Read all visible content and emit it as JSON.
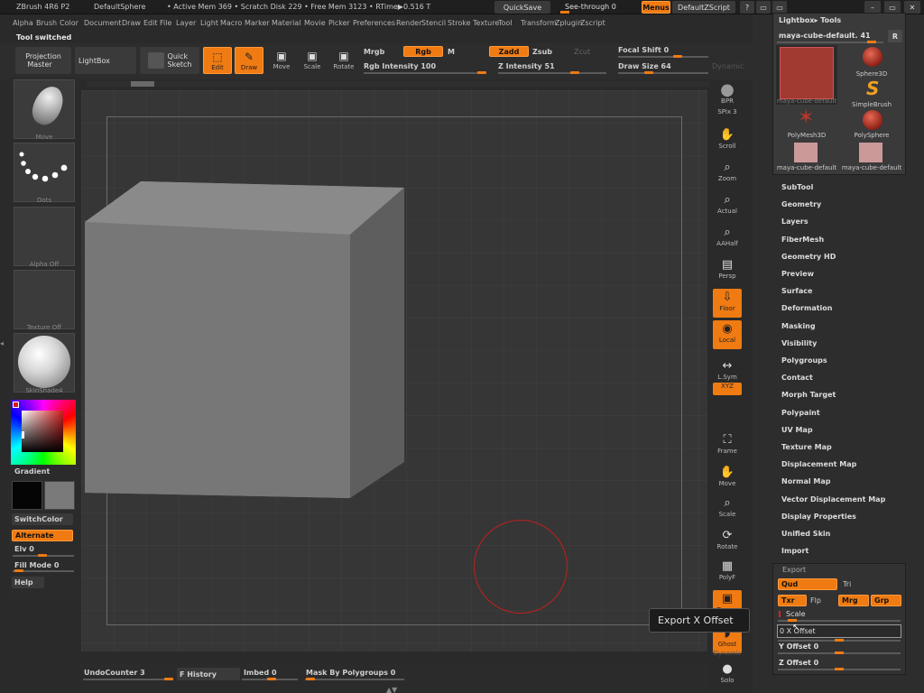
{
  "title_bar": {
    "app": "ZBrush 4R6 P2",
    "doc": "DefaultSphere",
    "stats": "• Active Mem 369 • Scratch Disk 229 • Free Mem 3123 • RTime▶0.516 T",
    "quicksave": "QuickSave",
    "see_through": "See-through  0",
    "menus": "Menus",
    "default_script": "DefaultZScript",
    "win_controls": [
      "?",
      "▭",
      "▭",
      "–",
      "▭",
      "✕"
    ]
  },
  "menu_bar": [
    "Alpha",
    "Brush",
    "Color",
    "Document",
    "Draw",
    "Edit",
    "File",
    "Layer",
    "Light",
    "Macro",
    "Marker",
    "Material",
    "Movie",
    "Picker",
    "Preferences",
    "Render",
    "Stencil",
    "Stroke",
    "Texture",
    "Tool",
    "Transform",
    "Zplugin",
    "Zscript"
  ],
  "status": "Tool switched",
  "toolbar": {
    "projection_master": "Projection\nMaster",
    "lightbox": "LightBox",
    "quick_sketch": "Quick\nSketch",
    "edit": "Edit",
    "draw": "Draw",
    "move": "Move",
    "scale": "Scale",
    "rotate": "Rotate",
    "mrgb": "Mrgb",
    "rgb": "Rgb",
    "m": "M",
    "zadd": "Zadd",
    "zsub": "Zsub",
    "zcut": "Zcut",
    "rgb_intensity": "Rgb  Intensity 100",
    "z_intensity": "Z  Intensity 51",
    "focal_shift": "Focal  Shift 0",
    "draw_size": "Draw  Size 64",
    "dynamic": "Dynamic"
  },
  "left_shelf": {
    "brush_label": "Move",
    "stroke_label": "Dots",
    "alpha_label": "Alpha  Off",
    "texture_label": "Texture  Off",
    "material_label": "SkinShade4",
    "gradient": "Gradient",
    "switch_color": "SwitchColor",
    "alternate": "Alternate",
    "elv": "Elv 0",
    "fill_mode": "Fill  Mode 0",
    "help": "Help"
  },
  "right_shelf": [
    {
      "label": "BPR",
      "icon": "bpr-sphere-icon"
    },
    {
      "label": "SPix 3",
      "icon": "spix-icon"
    },
    {
      "label": "Scroll",
      "icon": "scroll-hand-icon"
    },
    {
      "label": "Zoom",
      "icon": "zoom-icon"
    },
    {
      "label": "Actual",
      "icon": "actual-icon"
    },
    {
      "label": "AAHalf",
      "icon": "aahalf-icon"
    },
    {
      "label": "Persp",
      "icon": "persp-icon"
    },
    {
      "label": "Floor",
      "icon": "floor-icon"
    },
    {
      "label": "Local",
      "icon": "local-icon"
    },
    {
      "label": "L.Sym",
      "icon": "lsym-icon"
    },
    {
      "label": "XYZ",
      "icon": "xyz-icon"
    },
    {
      "label": "Frame",
      "icon": "frame-icon"
    },
    {
      "label": "Move",
      "icon": "move-hand-icon"
    },
    {
      "label": "Scale",
      "icon": "scale-icon"
    },
    {
      "label": "Rotate",
      "icon": "rotate-icon"
    },
    {
      "label": "PolyF",
      "icon": "polyf-icon"
    },
    {
      "label": "Transp",
      "icon": "transp-icon"
    },
    {
      "label": "Ghost",
      "icon": "ghost-icon"
    },
    {
      "label": "Dynamic",
      "icon": ""
    },
    {
      "label": "Solo",
      "icon": "solo-icon"
    }
  ],
  "tool_palette": {
    "header": "Lightbox▸ Tools",
    "current_tool": "maya-cube-default. 41",
    "r_button": "R",
    "tools": [
      {
        "name": "maya-cube-default",
        "kind": "cube"
      },
      {
        "name": "Sphere3D",
        "kind": "sphere"
      },
      {
        "name": "SimpleBrush",
        "kind": "s"
      },
      {
        "name": "PolyMesh3D",
        "kind": "star"
      },
      {
        "name": "PolySphere",
        "kind": "sphere"
      },
      {
        "name": "maya-cube-default",
        "kind": "pink"
      },
      {
        "name": "maya-cube-default",
        "kind": "pink"
      }
    ],
    "subpalettes": [
      "SubTool",
      "Geometry",
      "Layers",
      "FiberMesh",
      "Geometry HD",
      "Preview",
      "Surface",
      "Deformation",
      "Masking",
      "Visibility",
      "Polygroups",
      "Contact",
      "Morph Target",
      "Polypaint",
      "UV Map",
      "Texture Map",
      "Displacement Map",
      "Normal Map",
      "Vector Displacement Map",
      "Display Properties",
      "Unified Skin",
      "Import"
    ]
  },
  "export_panel": {
    "title": "Export",
    "qud": "Qud",
    "tri": "Tri",
    "txr": "Txr",
    "flp": "Flp",
    "mrg": "Mrg",
    "grp": "Grp",
    "scale": "Scale",
    "x_offset": "0  X Offset",
    "y_offset": "Y  Offset 0",
    "z_offset": "Z  Offset 0"
  },
  "tooltip": "Export X Offset",
  "bottom_bar": {
    "undo_counter": "UndoCounter 3",
    "history": "F History",
    "imbed": "Imbed 0",
    "mask_by_polygroups": "Mask By Polygroups 0"
  },
  "colors": {
    "accent": "#f07b12",
    "background": "#2a2a2a",
    "canvas": "#353535",
    "cube": "#777777"
  }
}
